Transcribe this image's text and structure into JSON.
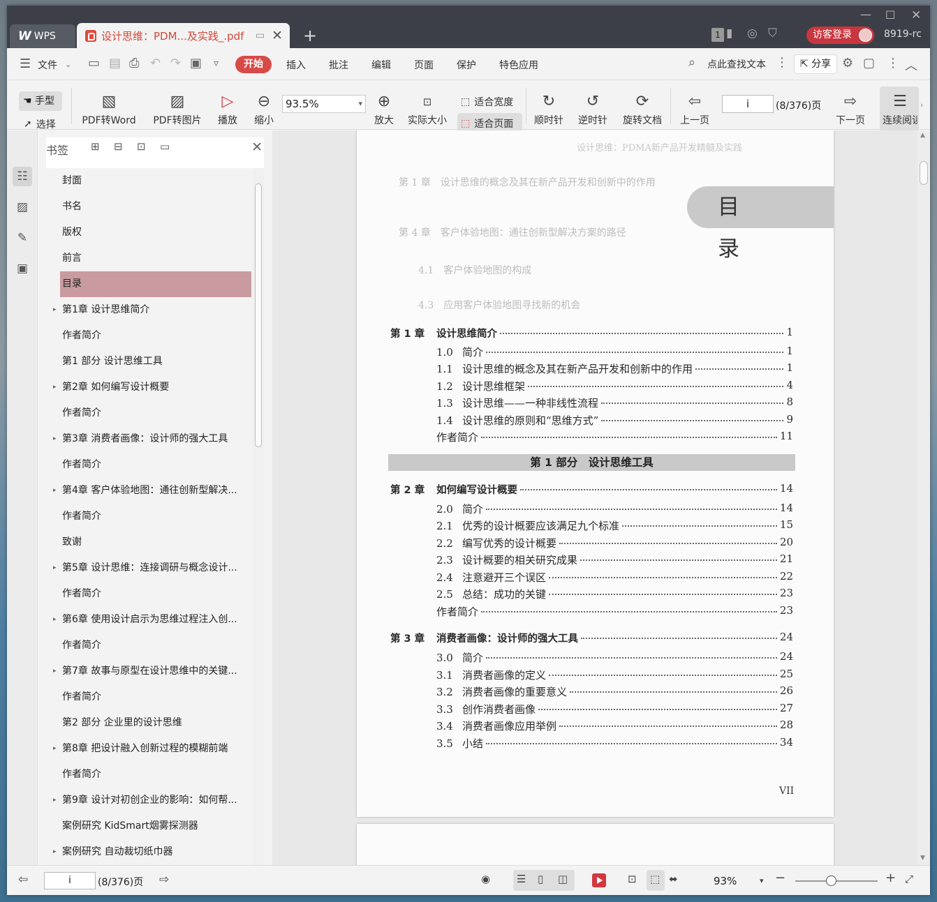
{
  "titlebar": {
    "wps_tab": "WPS",
    "doc_tab": "设计思维：PDM...及实践_.pdf",
    "badge": "1",
    "visitor": "访客登录",
    "user_id": "8919-rc"
  },
  "menu": {
    "file": "文件",
    "start": "开始",
    "insert": "插入",
    "annotate": "批注",
    "edit": "编辑",
    "page": "页面",
    "protect": "保护",
    "special": "特色应用",
    "search": "点此查找文本",
    "share": "分享"
  },
  "ribbon": {
    "hand": "手型",
    "select": "选择",
    "pdf2word": "PDF转Word",
    "pdf2img": "PDF转图片",
    "play": "播放",
    "zoom_out": "缩小",
    "zoom_value": "93.5%",
    "zoom_in": "放大",
    "actual_size": "实际大小",
    "fit_width": "适合宽度",
    "fit_page": "适合页面",
    "clockwise": "顺时针",
    "counter": "逆时针",
    "rotate_doc": "旋转文档",
    "prev_page": "上一页",
    "page_input": "i",
    "page_total": "(8/376)页",
    "next_page": "下一页",
    "continuous": "连续阅读"
  },
  "bookmarks": {
    "title": "书签",
    "items": [
      {
        "label": "封面",
        "exp": false
      },
      {
        "label": "书名",
        "exp": false
      },
      {
        "label": "版权",
        "exp": false
      },
      {
        "label": "前言",
        "exp": false
      },
      {
        "label": "目录",
        "exp": false,
        "selected": true
      },
      {
        "label": "第1章 设计思维简介",
        "exp": true
      },
      {
        "label": "作者简介",
        "exp": false
      },
      {
        "label": "第1 部分 设计思维工具",
        "exp": false
      },
      {
        "label": "第2章 如何编写设计概要",
        "exp": true
      },
      {
        "label": "作者简介",
        "exp": false
      },
      {
        "label": "第3章 消费者画像：设计师的强大工具",
        "exp": true
      },
      {
        "label": "作者简介",
        "exp": false
      },
      {
        "label": "第4章 客户体验地图：通往创新型解决...",
        "exp": true
      },
      {
        "label": "作者简介",
        "exp": false
      },
      {
        "label": "致谢",
        "exp": false
      },
      {
        "label": "第5章 设计思维：连接调研与概念设计...",
        "exp": true
      },
      {
        "label": "作者简介",
        "exp": false
      },
      {
        "label": "第6章 使用设计启示为思维过程注入创...",
        "exp": true
      },
      {
        "label": "作者简介",
        "exp": false
      },
      {
        "label": "第7章 故事与原型在设计思维中的关键...",
        "exp": true
      },
      {
        "label": "作者简介",
        "exp": false
      },
      {
        "label": "第2 部分 企业里的设计思维",
        "exp": false
      },
      {
        "label": "第8章 把设计融入创新过程的模糊前端",
        "exp": true
      },
      {
        "label": "作者简介",
        "exp": false
      },
      {
        "label": "第9章 设计对初创企业的影响：如何帮...",
        "exp": true
      },
      {
        "label": "案例研究 KidSmart烟雾探测器",
        "exp": false
      },
      {
        "label": "案例研究 自动裁切纸巾器",
        "exp": true
      }
    ]
  },
  "page": {
    "running_head": "设计思维：PDMA新产品开发精髓及实践",
    "heading": "目 录",
    "part1": "第 1 部分　设计思维工具",
    "footer": "VII",
    "toc": [
      {
        "num": "第 1 章",
        "title": "设计思维简介",
        "page": "1",
        "ch": true
      },
      {
        "num": "1.0",
        "title": "简介",
        "page": "1"
      },
      {
        "num": "1.1",
        "title": "设计思维的概念及其在新产品开发和创新中的作用",
        "page": "1"
      },
      {
        "num": "1.2",
        "title": "设计思维框架",
        "page": "4"
      },
      {
        "num": "1.3",
        "title": "设计思维——一种非线性流程",
        "page": "8"
      },
      {
        "num": "1.4",
        "title": "设计思维的原则和“思维方式”",
        "page": "9"
      },
      {
        "num": "",
        "title": "作者简介",
        "page": "11"
      },
      {
        "num": "第 2 章",
        "title": "如何编写设计概要",
        "page": "14",
        "ch": true
      },
      {
        "num": "2.0",
        "title": "简介",
        "page": "14"
      },
      {
        "num": "2.1",
        "title": "优秀的设计概要应该满足九个标准",
        "page": "15"
      },
      {
        "num": "2.2",
        "title": "编写优秀的设计概要",
        "page": "20"
      },
      {
        "num": "2.3",
        "title": "设计概要的相关研究成果",
        "page": "21"
      },
      {
        "num": "2.4",
        "title": "注意避开三个误区",
        "page": "22"
      },
      {
        "num": "2.5",
        "title": "总结：成功的关键",
        "page": "23"
      },
      {
        "num": "",
        "title": "作者简介",
        "page": "23"
      },
      {
        "num": "第 3 章",
        "title": "消费者画像：设计师的强大工具",
        "page": "24",
        "ch": true
      },
      {
        "num": "3.0",
        "title": "简介",
        "page": "24"
      },
      {
        "num": "3.1",
        "title": "消费者画像的定义",
        "page": "25"
      },
      {
        "num": "3.2",
        "title": "消费者画像的重要意义",
        "page": "26"
      },
      {
        "num": "3.3",
        "title": "创作消费者画像",
        "page": "27"
      },
      {
        "num": "3.4",
        "title": "消费者画像应用举例",
        "page": "28"
      },
      {
        "num": "3.5",
        "title": "小结",
        "page": "34"
      }
    ]
  },
  "status": {
    "page_input": "i",
    "page_total": "(8/376)页",
    "zoom": "93%"
  }
}
